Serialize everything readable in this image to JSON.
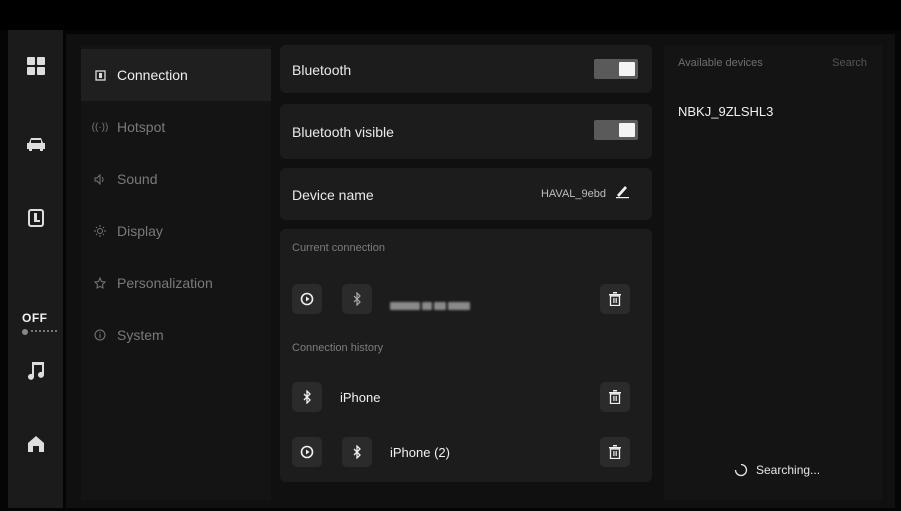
{
  "dock": {
    "items": [
      {
        "icon": "apps-grid-icon"
      },
      {
        "icon": "car-icon"
      },
      {
        "icon": "seat-icon"
      },
      {
        "icon": "music-note-icon"
      },
      {
        "icon": "home-icon"
      }
    ],
    "climate": {
      "state_label": "OFF",
      "icon": "fan-icon"
    }
  },
  "nav": {
    "items": [
      {
        "label": "Connection",
        "icon": "connection-icon",
        "active": true
      },
      {
        "label": "Hotspot",
        "icon": "hotspot-icon",
        "active": false
      },
      {
        "label": "Sound",
        "icon": "sound-icon",
        "active": false
      },
      {
        "label": "Display",
        "icon": "brightness-icon",
        "active": false
      },
      {
        "label": "Personalization",
        "icon": "personalization-icon",
        "active": false
      },
      {
        "label": "System",
        "icon": "info-icon",
        "active": false
      }
    ]
  },
  "settings": {
    "bluetooth": {
      "label": "Bluetooth",
      "enabled": true
    },
    "bluetooth_visible": {
      "label": "Bluetooth visible",
      "enabled": true
    },
    "device_name": {
      "label": "Device name",
      "value": "HAVAL_9ebd"
    }
  },
  "current_connection": {
    "title": "Current connection",
    "device": {
      "name": "",
      "obscured": true
    }
  },
  "connection_history": {
    "title": "Connection history",
    "devices": [
      {
        "name": "iPhone",
        "carplay": false
      },
      {
        "name": "iPhone (2)",
        "carplay": true
      }
    ]
  },
  "available": {
    "title": "Available devices",
    "search_label": "Search",
    "devices": [
      "NBKJ_9ZLSHL3"
    ],
    "status": "Searching..."
  },
  "colors": {
    "background": "#050505",
    "panel": "#1c1c1c",
    "toggle_on": "#5a5a5a",
    "accent_text": "#f0f0f0"
  }
}
